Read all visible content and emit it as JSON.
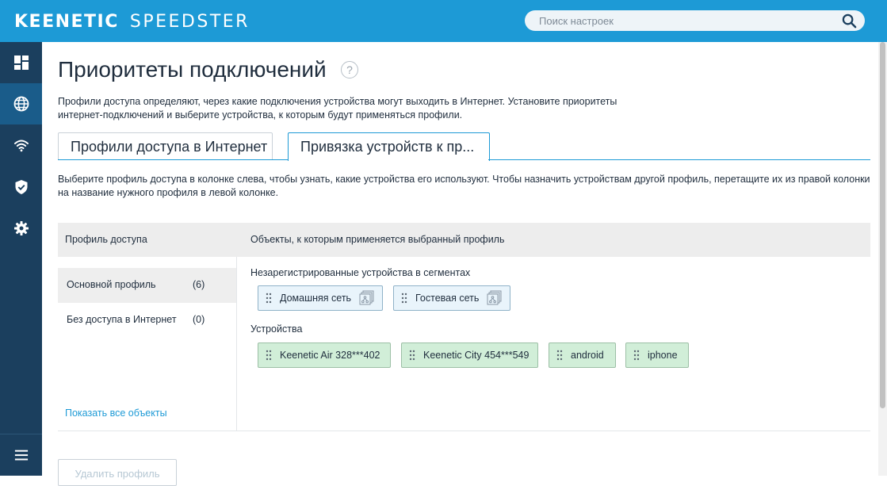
{
  "header": {
    "logo_main": "KEENETIC",
    "logo_sub": "SPEEDSTER",
    "search_placeholder": "Поиск настроек",
    "brand_color": "#1d9ad6"
  },
  "sidebar": {
    "items": [
      {
        "name": "dashboard",
        "icon": "dashboard-icon",
        "active": false
      },
      {
        "name": "internet",
        "icon": "globe-icon",
        "active": true
      },
      {
        "name": "wifi",
        "icon": "wifi-icon",
        "active": false
      },
      {
        "name": "security",
        "icon": "shield-icon",
        "active": false
      },
      {
        "name": "settings",
        "icon": "gear-icon",
        "active": false
      }
    ],
    "bottom_icon": "menu-icon"
  },
  "page": {
    "title": "Приоритеты подключений",
    "help": "?",
    "description": "Профили доступа определяют, через какие подключения устройства могут выходить в Интернет. Установите приоритеты интернет-подключений и выберите устройства, к которым будут применяться профили."
  },
  "tabs": [
    {
      "label": "Профили доступа в Интернет",
      "active": false
    },
    {
      "label": "Привязка устройств к пр...",
      "active": true
    }
  ],
  "tab_description": "Выберите профиль доступа в колонке слева, чтобы узнать, какие устройства его используют. Чтобы назначить устройствам другой профиль, перетащите их из правой колонки на название нужного профиля в левой колонке.",
  "table": {
    "left_header": "Профиль доступа",
    "right_header": "Объекты, к которым применяется выбранный профиль",
    "profiles": [
      {
        "name": "Основной профиль",
        "count": "(6)",
        "selected": true
      },
      {
        "name": "Без доступа в Интернет",
        "count": "(0)",
        "selected": false
      }
    ],
    "show_all": "Показать все объекты",
    "segments_label": "Незарегистрированные устройства в сегментах",
    "segments": [
      "Домашняя сеть",
      "Гостевая сеть"
    ],
    "devices_label": "Устройства",
    "devices": [
      "Keenetic Air 328***402",
      "Keenetic City 454***549",
      "android",
      "iphone"
    ]
  },
  "actions": {
    "delete_profile": "Удалить профиль"
  }
}
